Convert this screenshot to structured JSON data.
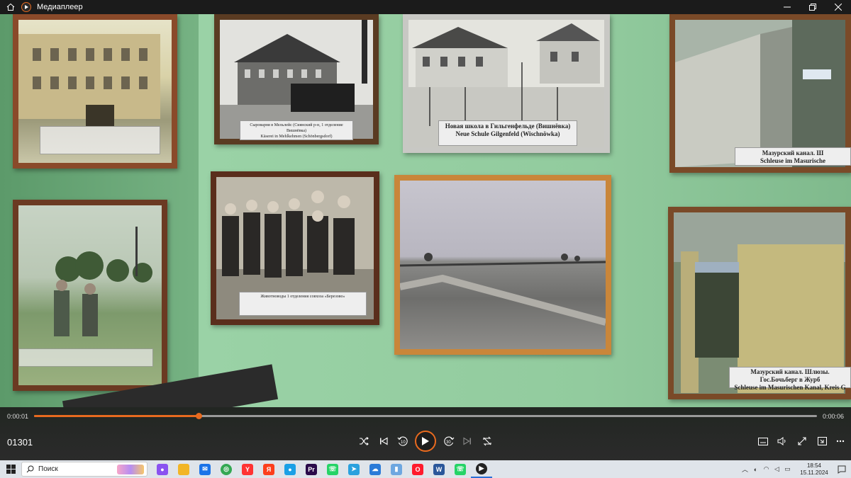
{
  "window": {
    "title": "Медиаплеер",
    "minimize_icon": "minimize-icon",
    "maximize_icon": "restore-icon",
    "close_icon": "close-icon"
  },
  "video": {
    "captions": {
      "photo2": "Сыроварня в Мельлейс (Сиянский р-н, 1 отделение Вишнёвка)",
      "photo2_line2": "Käserei in Mehlkehmen (Schönbergsdorf)",
      "photo3_ru": "Новая школа в Гильгенфельде (Вишнёвка)",
      "photo3_de": "Neue Schule Gilgenfeld (Wischnöwka)",
      "photo4_ru": "Мазурский канал. Ш",
      "photo4_de": "Schleuse im Masurische",
      "photo6": "Животноводы 1 отделения совхоза «Березово»",
      "photo9_ru": "Мазурский канал. Шлюзы. Гос.Бочьберг в Журб",
      "photo9_de": "Schleuse im Masurischen Kanal, Kreis G"
    }
  },
  "player": {
    "current_time": "0:00:01",
    "total_time": "0:00:06",
    "progress_fraction": 0.21,
    "clip_title": "01301",
    "buttons": {
      "shuffle": "shuffle-icon",
      "previous": "previous-icon",
      "rewind": "rewind-10-icon",
      "play": "play-icon",
      "forward": "forward-30-icon",
      "next": "next-icon",
      "repeat": "repeat-icon",
      "subtitles": "subtitles-icon",
      "volume": "volume-icon",
      "fullscreen": "fullscreen-icon",
      "miniplayer": "miniplayer-icon",
      "more": "more-icon"
    },
    "accent_color": "#e86a1f"
  },
  "taskbar": {
    "search_placeholder": "Поиск",
    "apps": [
      {
        "name": "alice",
        "color": "#8a52f0",
        "glyph": "●"
      },
      {
        "name": "file-explorer",
        "color": "#f2b526",
        "glyph": ""
      },
      {
        "name": "mail",
        "color": "#1a73e8",
        "glyph": "✉"
      },
      {
        "name": "chrome",
        "color": "#34a853",
        "glyph": "◎"
      },
      {
        "name": "yandex-browser",
        "color": "#ff3333",
        "glyph": "Y"
      },
      {
        "name": "yandex",
        "color": "#fc3f1d",
        "glyph": "Я"
      },
      {
        "name": "browser-blue",
        "color": "#1aa0e6",
        "glyph": "●"
      },
      {
        "name": "premiere",
        "color": "#2a0a4a",
        "glyph": "Pr"
      },
      {
        "name": "whatsapp",
        "color": "#25d366",
        "glyph": "☏"
      },
      {
        "name": "telegram",
        "color": "#2aa1de",
        "glyph": "➤"
      },
      {
        "name": "cloud",
        "color": "#2b7bd8",
        "glyph": "☁"
      },
      {
        "name": "disk",
        "color": "#6ea7e0",
        "glyph": "▮"
      },
      {
        "name": "opera",
        "color": "#ff1b2d",
        "glyph": "O"
      },
      {
        "name": "word",
        "color": "#2b579a",
        "glyph": "W"
      },
      {
        "name": "whatsapp-2",
        "color": "#25d366",
        "glyph": "☏"
      },
      {
        "name": "media-player",
        "color": "#222222",
        "glyph": "▶"
      }
    ],
    "time": "18:54",
    "date": "15.11.2024"
  }
}
